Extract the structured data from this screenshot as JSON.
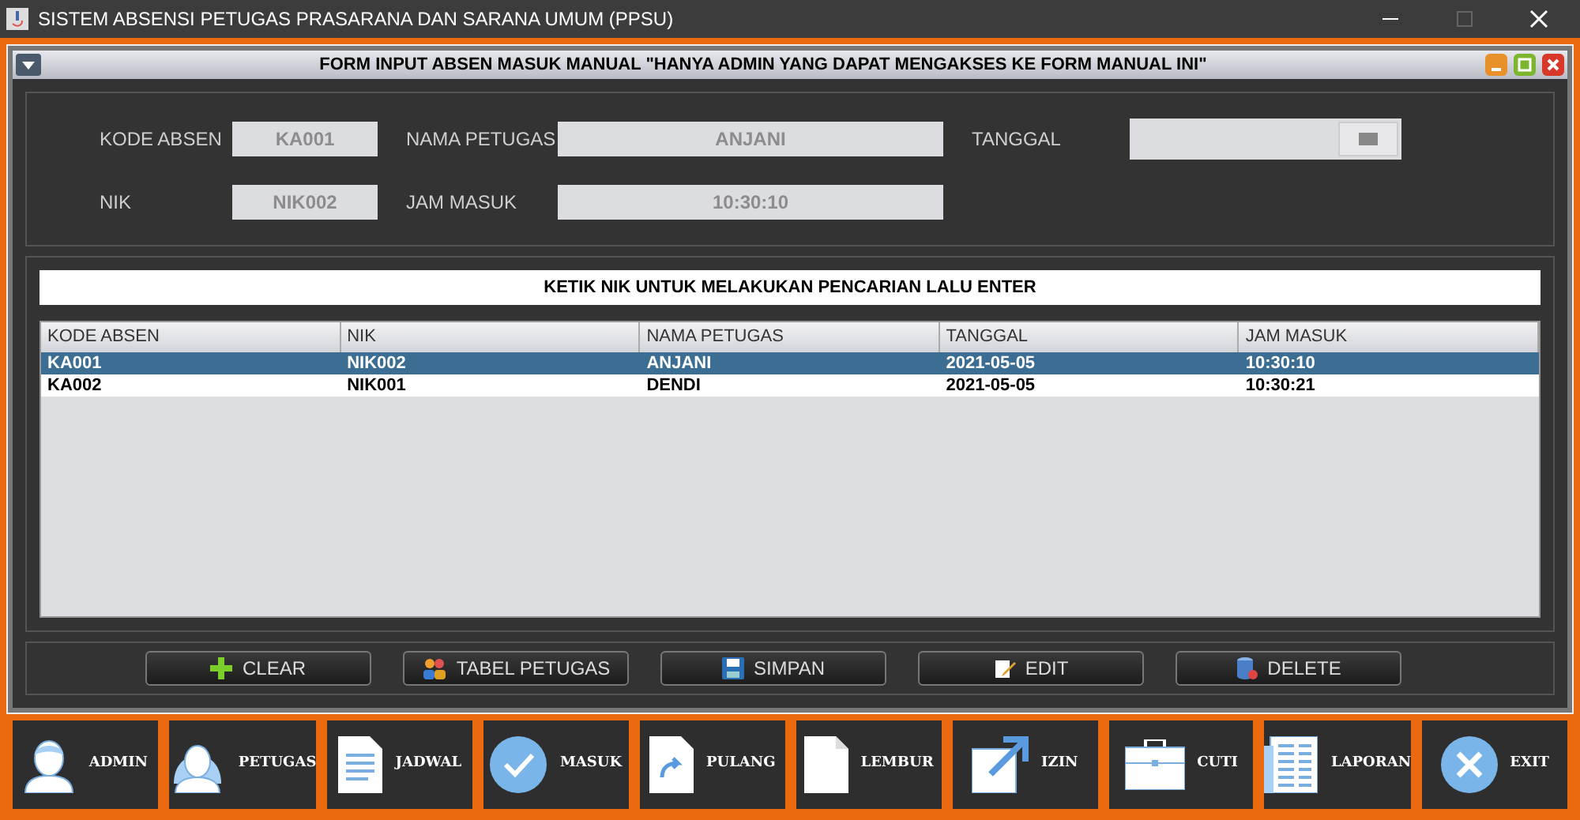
{
  "window": {
    "title": "SISTEM ABSENSI PETUGAS PRASARANA DAN SARANA UMUM (PPSU)"
  },
  "form": {
    "title": "FORM INPUT ABSEN MASUK MANUAL \"HANYA ADMIN YANG DAPAT MENGAKSES KE FORM MANUAL INI\"",
    "fields": {
      "kode_absen": {
        "label": "KODE ABSEN",
        "value": "KA001"
      },
      "nama_petugas": {
        "label": "NAMA PETUGAS",
        "value": "ANJANI"
      },
      "tanggal": {
        "label": "TANGGAL"
      },
      "nik": {
        "label": "NIK",
        "value": "NIK002"
      },
      "jam_masuk": {
        "label": "JAM MASUK",
        "value": "10:30:10"
      }
    },
    "search": {
      "placeholder": "KETIK NIK UNTUK MELAKUKAN PENCARIAN LALU ENTER"
    },
    "table": {
      "columns": [
        "KODE ABSEN",
        "NIK",
        "NAMA PETUGAS",
        "TANGGAL",
        "JAM MASUK"
      ],
      "rows": [
        {
          "cells": [
            "KA001",
            "NIK002",
            "ANJANI",
            "2021-05-05",
            "10:30:10"
          ],
          "selected": true
        },
        {
          "cells": [
            "KA002",
            "NIK001",
            "DENDI",
            "2021-05-05",
            "10:30:21"
          ],
          "selected": false
        }
      ]
    },
    "buttons": [
      "CLEAR",
      "TABEL PETUGAS",
      "SIMPAN",
      "EDIT",
      "DELETE"
    ]
  },
  "nav": [
    "ADMIN",
    "PETUGAS",
    "JADWAL",
    "MASUK",
    "PULANG",
    "LEMBUR",
    "IZIN",
    "CUTI",
    "LAPORAN",
    "EXIT"
  ]
}
